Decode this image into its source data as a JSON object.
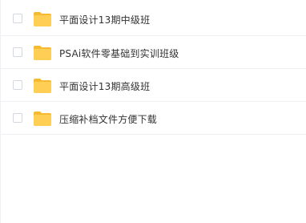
{
  "files": [
    {
      "name": "平面设计13期中级班",
      "icon": "folder-icon",
      "checked": false
    },
    {
      "name": "PSAi软件零基础到实训班级",
      "icon": "folder-icon",
      "checked": false
    },
    {
      "name": "平面设计13期高级班",
      "icon": "folder-icon",
      "checked": false
    },
    {
      "name": "压缩补档文件方便下载",
      "icon": "folder-icon",
      "checked": false
    }
  ],
  "colors": {
    "folder": "#ffc94d",
    "folder_tab": "#f5b932",
    "border": "#eef0f3",
    "text": "#333333"
  }
}
